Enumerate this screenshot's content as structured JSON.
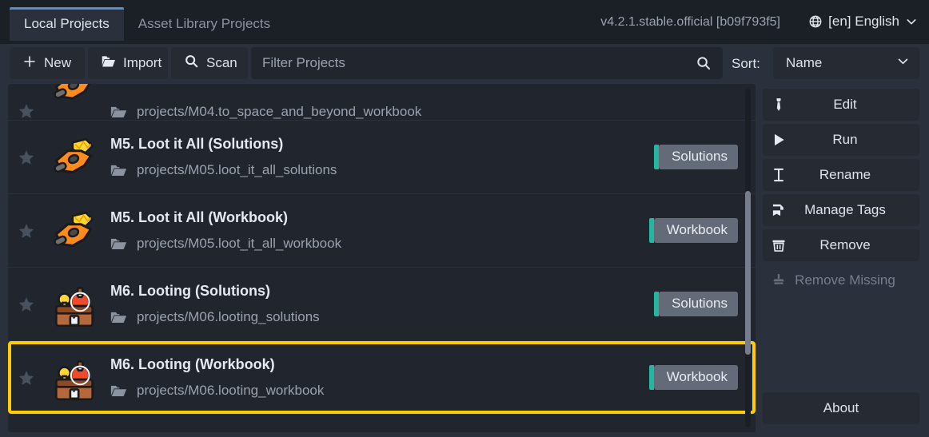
{
  "window": {
    "version": "v4.2.1.stable.official [b09f793f5]"
  },
  "tabs": [
    {
      "label": "Local Projects",
      "active": true
    },
    {
      "label": "Asset Library Projects",
      "active": false
    }
  ],
  "language": {
    "icon": "globe-icon",
    "label": "[en] English",
    "chevron": "chevron-down-icon"
  },
  "toolbar": {
    "new_label": "New",
    "import_label": "Import",
    "scan_label": "Scan",
    "filter_placeholder": "Filter Projects",
    "filter_value": "",
    "search_icon": "search-icon",
    "sort_label": "Sort:",
    "sort_value": "Name",
    "sort_options": [
      "Name"
    ]
  },
  "projects": [
    {
      "title": "",
      "path": "projects/M04.to_space_and_beyond_workbook",
      "tag": "",
      "icon": "spaceship-gem-icon",
      "favorite": false,
      "selected": false,
      "clipped": true
    },
    {
      "title": "M5. Loot it All (Solutions)",
      "path": "projects/M05.loot_it_all_solutions",
      "tag": "Solutions",
      "icon": "spaceship-gem-icon",
      "favorite": false,
      "selected": false,
      "clipped": false
    },
    {
      "title": "M5. Loot it All (Workbook)",
      "path": "projects/M05.loot_it_all_workbook",
      "tag": "Workbook",
      "icon": "spaceship-gem-icon",
      "favorite": false,
      "selected": false,
      "clipped": false
    },
    {
      "title": "M6. Looting (Solutions)",
      "path": "projects/M06.looting_solutions",
      "tag": "Solutions",
      "icon": "treasure-chest-icon",
      "favorite": false,
      "selected": false,
      "clipped": false
    },
    {
      "title": "M6. Looting (Workbook)",
      "path": "projects/M06.looting_workbook",
      "tag": "Workbook",
      "icon": "treasure-chest-icon",
      "favorite": false,
      "selected": true,
      "clipped": false
    }
  ],
  "sidebar": {
    "buttons": [
      {
        "label": "Edit",
        "icon": "pencil-icon",
        "disabled": false
      },
      {
        "label": "Run",
        "icon": "play-icon",
        "disabled": false
      },
      {
        "label": "Rename",
        "icon": "text-cursor-icon",
        "disabled": false
      },
      {
        "label": "Manage Tags",
        "icon": "tag-icon",
        "disabled": false
      },
      {
        "label": "Remove",
        "icon": "trash-icon",
        "disabled": false
      },
      {
        "label": "Remove Missing",
        "icon": "broom-icon",
        "disabled": true
      }
    ],
    "about_label": "About"
  },
  "colors": {
    "accent_tab": "#5a8fc8",
    "selection_outline": "#ffcc00",
    "tag_accent": "#25b6a2",
    "panel_bg": "#2b313c",
    "list_bg": "#21262e"
  }
}
